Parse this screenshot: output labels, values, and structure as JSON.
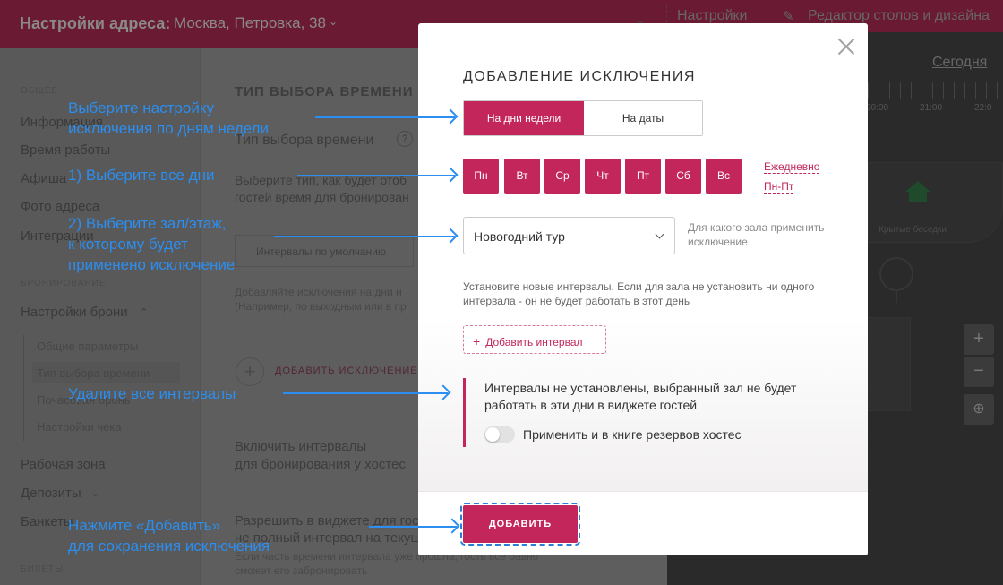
{
  "topbar": {
    "title": "Настройки адреса:",
    "address": "Москва, Петровка, 38",
    "nav_settings": "Настройки",
    "nav_editor": "Редактор столов и дизайна"
  },
  "sidebar": {
    "section_general": "ОБЩЕЕ",
    "items": [
      "Информация",
      "Время работы",
      "Афиша",
      "Фото адреса",
      "Интеграции"
    ],
    "section_booking": "БРОНИРОВАНИЕ",
    "booking_settings": "Настройки брони",
    "sub_items": [
      "Общие параметры",
      "Тип выбора времени",
      "Почасовая бронь",
      "Настройки чека"
    ],
    "items_bottom": [
      "Рабочая зона",
      "Депозиты",
      "Банкеты"
    ],
    "section_tickets": "БИЛЕТЫ"
  },
  "content": {
    "heading": "ТИП ВЫБОРА ВРЕМЕНИ",
    "subheading": "Тип выбора времени",
    "desc_1": "Выберите тип, как будет отоб",
    "desc_2": "гостей время для бронирован",
    "default_intervals": "Интервалы по умолчанию",
    "add_hint_1": "Добавляйте исключения на дни н",
    "add_hint_2": "(Например, по выходным или в пр",
    "add_exception": "ДОБАВИТЬ ИСКЛЮЧЕНИЕ",
    "enable_1": "Включить интервалы",
    "enable_2": "для бронирования у хостес",
    "allow_1": "Разрешить в виджете для гост",
    "allow_2": "не полный интервал на текущ",
    "allow_3": "Если часть времени интервала уже прошла, гость все равно",
    "allow_4": "сможет его забронировать"
  },
  "map": {
    "today": "Сегодня",
    "times": [
      "20:00",
      "21:00",
      "22:0"
    ],
    "label_covered": "Крытые беседки",
    "zoom_in": "+",
    "zoom_out": "−"
  },
  "modal": {
    "title": "ДОБАВЛЕНИЕ ИСКЛЮЧЕНИЯ",
    "tab_weekdays": "На дни недели",
    "tab_dates": "На даты",
    "days": [
      "Пн",
      "Вт",
      "Ср",
      "Чт",
      "Пт",
      "Сб",
      "Вс"
    ],
    "link_daily": "Ежедневно",
    "link_weekdays": "Пн-Пт",
    "hall_select": "Новогодний тур",
    "hall_hint": "Для какого зала применить исключение",
    "intervals_note": "Установите новые интервалы. Если для зала не установить ни одного интервала - он не будет работать в этот день",
    "add_interval": "Добавить интервал",
    "warning": "Интервалы не установлены, выбранный зал не будет работать в эти дни в виджете гостей",
    "apply_hostess": "Применить и в книге резервов хостес",
    "submit": "ДОБАВИТЬ"
  },
  "annotations": {
    "a1_l1": "Выберите настройку",
    "a1_l2": "исключения по дням недели",
    "a2": "1) Выберите все дни",
    "a3_l1": "2) Выберите зал/этаж,",
    "a3_l2": "к которому будет",
    "a3_l3": "применено исключение",
    "a4": "Удалите все интервалы",
    "a5_l1": "Нажмите «Добавить»",
    "a5_l2": "для сохранения исключения"
  },
  "colors": {
    "accent": "#c2265b",
    "annotation": "#2b8ef0"
  }
}
